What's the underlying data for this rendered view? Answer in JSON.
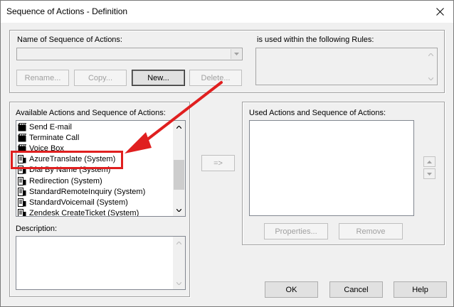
{
  "window": {
    "title": "Sequence of Actions - Definition"
  },
  "sequence_group": {
    "name_label": "Name of Sequence of Actions:",
    "name_value": "",
    "rules_label": "is used within the following Rules:",
    "buttons": {
      "rename": "Rename...",
      "copy": "Copy...",
      "new": "New...",
      "delete": "Delete..."
    }
  },
  "available_group": {
    "label": "Available Actions and Sequence of Actions:",
    "items": [
      {
        "label": "Send E-mail",
        "icon": "action-icon"
      },
      {
        "label": "Terminate Call",
        "icon": "action-icon"
      },
      {
        "label": "Voice Box",
        "icon": "action-icon"
      },
      {
        "label": "AzureTranslate (System)",
        "icon": "sequence-icon"
      },
      {
        "label": "Dial By Name (System)",
        "icon": "sequence-icon"
      },
      {
        "label": "Redirection (System)",
        "icon": "sequence-icon"
      },
      {
        "label": "StandardRemoteInquiry (System)",
        "icon": "sequence-icon"
      },
      {
        "label": "StandardVoicemail (System)",
        "icon": "sequence-icon"
      },
      {
        "label": "Zendesk CreateTicket (System)",
        "icon": "sequence-icon"
      }
    ],
    "description_label": "Description:",
    "add_button": "=>"
  },
  "used_group": {
    "label": "Used Actions and Sequence of Actions:",
    "properties_button": "Properties...",
    "remove_button": "Remove"
  },
  "footer": {
    "ok": "OK",
    "cancel": "Cancel",
    "help": "Help"
  },
  "annotation": {
    "highlight_color": "#e01f1f",
    "highlighted_item": "AzureTranslate (System)"
  }
}
